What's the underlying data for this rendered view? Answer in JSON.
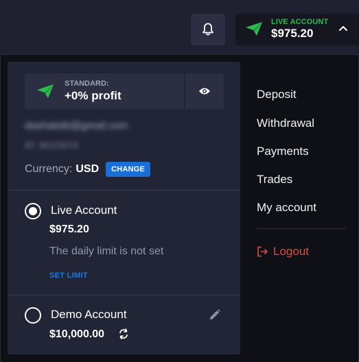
{
  "header": {
    "account_type": "LIVE ACCOUNT",
    "balance": "$975.20",
    "notifications_icon": "bell-icon",
    "toggle_icon": "chevron-up-icon"
  },
  "profile": {
    "tier_label": "STANDARD:",
    "tier_profit": "+0% profit",
    "email": "dashaleiki@gmail.com",
    "user_id": "ID: 36123214",
    "currency_label": "Currency:",
    "currency_value": "USD",
    "change_label": "CHANGE"
  },
  "accounts": {
    "live": {
      "title": "Live Account",
      "balance": "$975.20",
      "note": "The daily limit is not set",
      "set_limit_label": "SET LIMIT",
      "selected": true
    },
    "demo": {
      "title": "Demo Account",
      "balance": "$10,000.00",
      "selected": false
    }
  },
  "menu": {
    "items": [
      {
        "label": "Deposit"
      },
      {
        "label": "Withdrawal"
      },
      {
        "label": "Payments"
      },
      {
        "label": "Trades"
      },
      {
        "label": "My account"
      }
    ],
    "logout_label": "Logout"
  },
  "colors": {
    "accent_green": "#2dbc4e",
    "accent_blue": "#1a6fd6",
    "logout_red": "#e04a45"
  }
}
